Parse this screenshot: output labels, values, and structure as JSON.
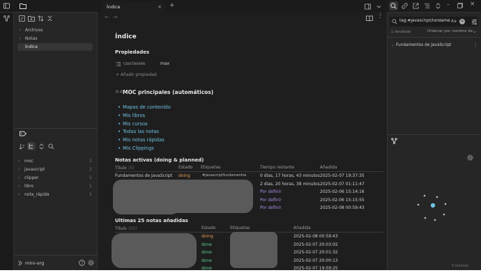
{
  "sidebar": {
    "files": [
      {
        "label": "Archivos"
      },
      {
        "label": "Notas"
      },
      {
        "label": "Índice"
      }
    ],
    "tags": [
      {
        "label": "moc",
        "count": "1"
      },
      {
        "label": "javascript",
        "count": "1"
      },
      {
        "label": "clipper",
        "count": "1"
      },
      {
        "label": "libro",
        "count": "1"
      },
      {
        "label": "nota_rápida",
        "count": "1"
      }
    ],
    "vault_name": "mini-org"
  },
  "tab": {
    "title": "Índice",
    "new_tab": "+"
  },
  "note": {
    "title": "Índice",
    "properties_heading": "Propiedades",
    "property_name": "cssclasses",
    "property_value": "max",
    "add_property": "Añadir propiedad",
    "moc_marker": "##",
    "moc_heading": "MOC principales (automáticos)",
    "moc_links": [
      "Mapas de contenido",
      "Mis libros",
      "Mis cursos",
      "Todas las notas",
      "Mis notas rápidas",
      "Mis Clippings"
    ],
    "active_heading": "Notas activas (doing & planned)",
    "active_headers": {
      "title": "Título",
      "title_count": "(5)",
      "status": "Estado",
      "tags": "Etiquetas",
      "remaining": "Tiempo restante",
      "added": "Añadida"
    },
    "active_rows": [
      {
        "title": "Fundamentos de JavaScript",
        "status": "doing",
        "tags": "#javascript/fundamentos",
        "remaining": "0 días, 17 horas, 43 minutos",
        "added": "2025-02-07 19:37:35"
      },
      {
        "title": "",
        "status": "planned",
        "tags": "",
        "remaining": "2 días, 20 horas, 38 minutos",
        "added": "2025-02-07 01:11:47"
      },
      {
        "title": "",
        "status": "doing",
        "tags": "",
        "remaining": "Por definir",
        "added": "2025-02-06 15:14:16"
      },
      {
        "title": "",
        "status": "planned",
        "tags": "",
        "remaining": "Por definir",
        "added": "2025-02-06 15:15:55"
      },
      {
        "title": "",
        "status": "doing",
        "tags": "",
        "remaining": "Por definir",
        "added": "2025-02-08 00:59:43"
      }
    ],
    "recent_heading": "Ultimas 25 notas añadidas",
    "recent_headers": {
      "title": "Título",
      "title_count": "(25)",
      "status": "Estado",
      "tags": "Etiquetas",
      "added": "Añadida"
    },
    "recent_rows": [
      {
        "status": "doing",
        "added": "2025-02-08 00:59:43"
      },
      {
        "status": "done",
        "added": "2025-02-07 20:03:02"
      },
      {
        "status": "done",
        "added": "2025-02-07 20:01:32"
      },
      {
        "status": "done",
        "added": "2025-02-07 20:00:13"
      },
      {
        "status": "done",
        "added": "2025-02-07 19:59:25"
      }
    ]
  },
  "right_panel": {
    "search_query": "tag:#javascript/fundamentos",
    "match_case": "Aa",
    "result_count": "1 resultado",
    "sort_label": "Ordenar por nombre de…",
    "result_item": "Fundamentos de JavaScript",
    "backlinks_label": "0 enlaces"
  },
  "colors": {
    "accent": "#6fc2e3",
    "doing": "#e59a4f",
    "planned": "#a88be6",
    "done": "#5cc98b"
  }
}
